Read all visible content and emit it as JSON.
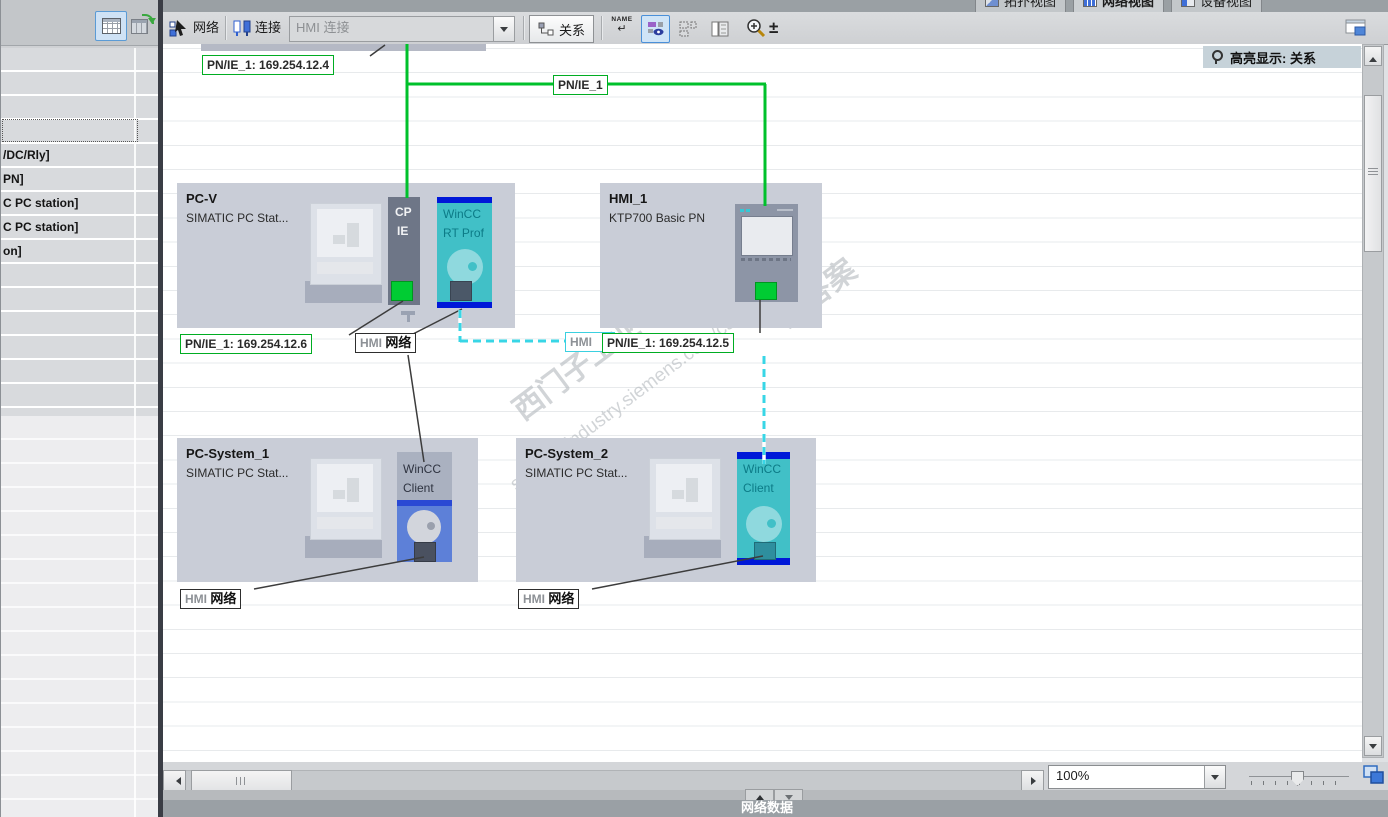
{
  "window": {
    "highlight_banner": "高亮显示: 关系"
  },
  "tabs": [
    {
      "label": "拓扑视图"
    },
    {
      "label": "网络视图"
    },
    {
      "label": "设备视图"
    }
  ],
  "toolbar": {
    "network_label": "网络",
    "connections_label": "连接",
    "connection_combo_value": "HMI 连接",
    "relations_label": "关系",
    "name_badge": "NAME",
    "name_badge_return": "↵",
    "zoom_glyph": "±"
  },
  "left_panel": {
    "rows": [
      "/DC/Rly]",
      "PN]",
      "C PC station]",
      "C PC station]",
      "on]"
    ]
  },
  "network_view": {
    "labels": {
      "top_ip": "PN/IE_1: 169.254.12.4",
      "trunk": "PN/IE_1",
      "pcv_ip": "PN/IE_1: 169.254.12.6",
      "hmi_ip": "PN/IE_1: 169.254.12.5",
      "hmi_connection": "HMI",
      "net_prefix": "HMI",
      "net_suffix": "网络"
    },
    "devices": {
      "pcv": {
        "name": "PC-V",
        "type": "SIMATIC PC Stat...",
        "cp_top": "CP",
        "cp_bottom": "IE",
        "app_top": "WinCC",
        "app_bottom": "RT Prof"
      },
      "hmi1": {
        "name": "HMI_1",
        "type": "KTP700 Basic PN"
      },
      "pcs1": {
        "name": "PC-System_1",
        "type": "SIMATIC PC Stat...",
        "app_top": "WinCC",
        "app_bottom": "Client"
      },
      "pcs2": {
        "name": "PC-System_2",
        "type": "SIMATIC PC Stat...",
        "app_top": "WinCC",
        "app_bottom": "Client"
      }
    },
    "watermark": {
      "line1": "西门子工业",
      "line2": "support.industry.siemens.com/cs",
      "line3": "找答案"
    }
  },
  "status_bar": {
    "zoom_value": "100%",
    "bottom_tab_label": "网络数据"
  },
  "colors": {
    "subnet_green": "#00c12b",
    "hmi_cyan": "#38d6e6",
    "module_teal": "#41c0c7",
    "selection_blue": "#0018d8",
    "port_green": "#00cc33"
  }
}
